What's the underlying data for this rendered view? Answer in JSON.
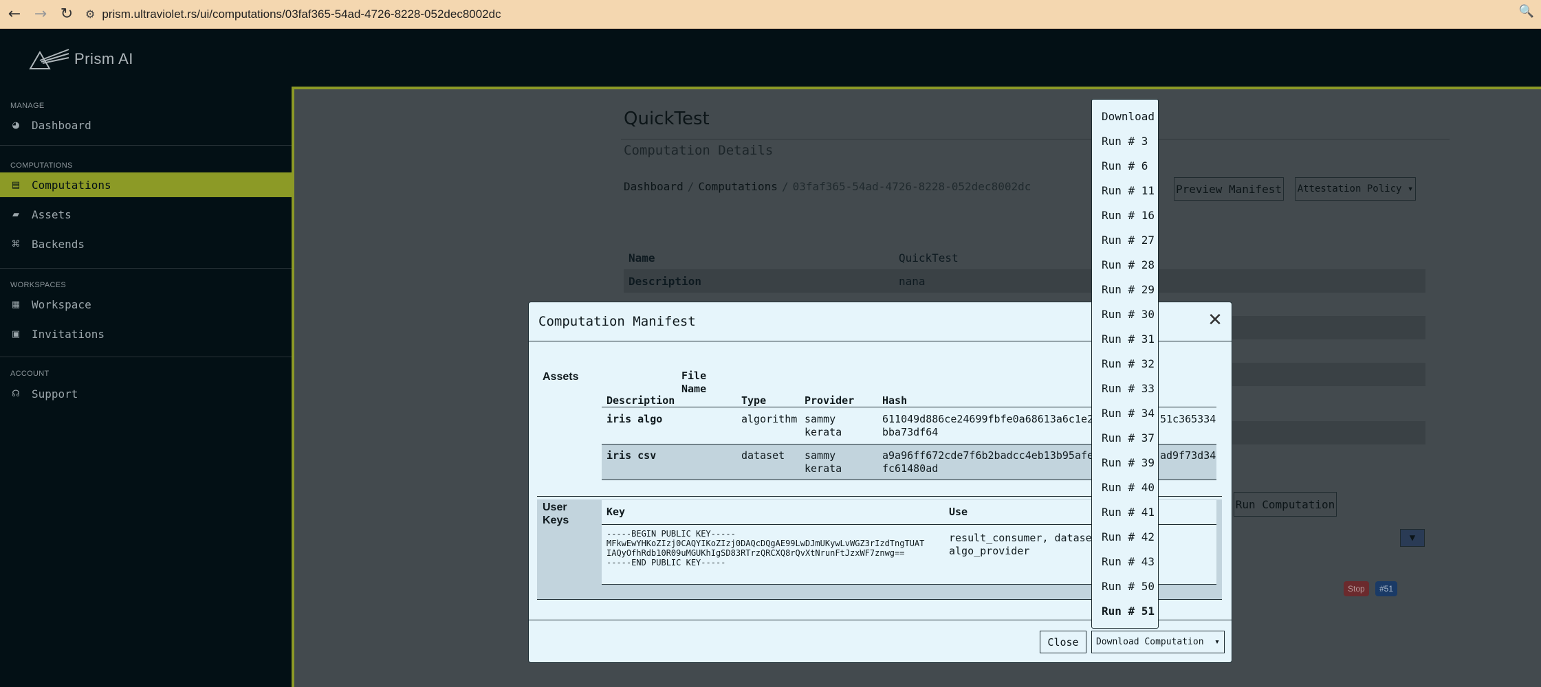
{
  "browser": {
    "url": "prism.ultraviolet.rs/ui/computations/03faf365-54ad-4726-8228-052dec8002dc",
    "back_icon": "←",
    "forward_icon": "→",
    "reload_icon": "↻",
    "site_info_icon": "⚙",
    "search_icon": "🔍"
  },
  "app": {
    "name": "Prism AI"
  },
  "sidebar": {
    "manage_label": "MANAGE",
    "computations_label": "COMPUTATIONS",
    "workspaces_label": "WORKSPACES",
    "account_label": "ACCOUNT",
    "items": [
      {
        "label": "Dashboard",
        "icon": "◕"
      },
      {
        "label": "Computations",
        "icon": "▤"
      },
      {
        "label": "Assets",
        "icon": "▰"
      },
      {
        "label": "Backends",
        "icon": "⌘"
      },
      {
        "label": "Workspace",
        "icon": "▦"
      },
      {
        "label": "Invitations",
        "icon": "▣"
      },
      {
        "label": "Support",
        "icon": "☊"
      }
    ]
  },
  "page": {
    "title": "QuickTest",
    "subtitle": "Computation Details",
    "breadcrumb": [
      "Dashboard",
      "Computations",
      "03faf365-54ad-4726-8228-052dec8002dc"
    ],
    "preview_manifest": "Preview Manifest",
    "attestation_policy": "Attestation Policy",
    "run_computation": "Run Computation",
    "details": [
      {
        "key": "Name",
        "value": "QuickTest"
      },
      {
        "key": "Description",
        "value": "nana"
      }
    ],
    "stop_badge": "Stop",
    "run_badge": "#51",
    "filter_icon": "▼"
  },
  "modal": {
    "title": "Computation Manifest",
    "close_icon": "✕",
    "assets_label": "Assets",
    "asset_headers": {
      "description": "Description",
      "file_name": "File Name",
      "type": "Type",
      "provider": "Provider",
      "hash": "Hash"
    },
    "assets": [
      {
        "description": "iris algo",
        "type": "algorithm",
        "provider_1": "sammy",
        "provider_2": "kerata",
        "hash_1": "611049d886ce24699fbfe0a68613a6c1e29",
        "hash_tail_1": "51c365334",
        "hash_2": "bba73df64"
      },
      {
        "description": "iris csv",
        "type": "dataset",
        "provider_1": "sammy",
        "provider_2": "kerata",
        "hash_1": "a9a96ff672cde7f6b2badcc4eb13b95afe5",
        "hash_tail_1": "ad9f73d34",
        "hash_2": "fc61480ad"
      }
    ],
    "user_keys_label_1": "User",
    "user_keys_label_2": "Keys",
    "key_header": "Key",
    "use_header": "Use",
    "key_lines": [
      "-----BEGIN PUBLIC KEY-----",
      "MFkwEwYHKoZIzj0CAQYIKoZIzj0DAQcDQgAE99LwDJmUKywLvWGZ3rIzdTngTUAT",
      "IAQyOfhRdb10R09uMGUKhIgSD83RTrzQRCXQ8rQvXtNrunFtJzxWF7znwg==",
      "-----END PUBLIC KEY-----"
    ],
    "use_line_1": "result_consumer, dataset",
    "use_line_2": "algo_provider",
    "close_button": "Close",
    "download_button": "Download Computation"
  },
  "dropdown": {
    "items": [
      "Download",
      "Run # 3",
      "Run # 6",
      "Run # 11",
      "Run # 16",
      "Run # 27",
      "Run # 28",
      "Run # 29",
      "Run # 30",
      "Run # 31",
      "Run # 32",
      "Run # 33",
      "Run # 34",
      "Run # 37",
      "Run # 39",
      "Run # 40",
      "Run # 41",
      "Run # 42",
      "Run # 43",
      "Run # 50",
      "Run # 51"
    ]
  }
}
